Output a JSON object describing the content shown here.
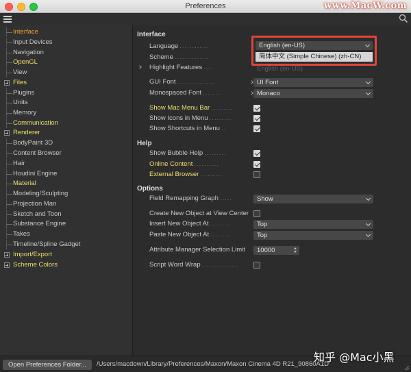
{
  "window": {
    "title": "Preferences",
    "watermark": "www.MacW.com"
  },
  "toolbar": {
    "menu_icon": "hamburger-menu-icon",
    "search_icon": "search-icon"
  },
  "sidebar": {
    "items": [
      {
        "label": "Interface",
        "expandable": false,
        "color": "orange"
      },
      {
        "label": "Input Devices",
        "expandable": false,
        "color": "normal"
      },
      {
        "label": "Navigation",
        "expandable": false,
        "color": "normal"
      },
      {
        "label": "OpenGL",
        "expandable": false,
        "color": "yellow"
      },
      {
        "label": "View",
        "expandable": false,
        "color": "normal"
      },
      {
        "label": "Files",
        "expandable": true,
        "color": "yellow"
      },
      {
        "label": "Plugins",
        "expandable": false,
        "color": "normal"
      },
      {
        "label": "Units",
        "expandable": false,
        "color": "normal"
      },
      {
        "label": "Memory",
        "expandable": false,
        "color": "normal"
      },
      {
        "label": "Communication",
        "expandable": false,
        "color": "yellow"
      },
      {
        "label": "Renderer",
        "expandable": true,
        "color": "yellow"
      },
      {
        "label": "BodyPaint 3D",
        "expandable": false,
        "color": "normal"
      },
      {
        "label": "Content Browser",
        "expandable": false,
        "color": "normal"
      },
      {
        "label": "Hair",
        "expandable": false,
        "color": "normal"
      },
      {
        "label": "Houdini Engine",
        "expandable": false,
        "color": "normal"
      },
      {
        "label": "Material",
        "expandable": false,
        "color": "yellow"
      },
      {
        "label": "Modeling/Sculpting",
        "expandable": false,
        "color": "normal"
      },
      {
        "label": "Projection Man",
        "expandable": false,
        "color": "normal"
      },
      {
        "label": "Sketch and Toon",
        "expandable": false,
        "color": "normal"
      },
      {
        "label": "Substance Engine",
        "expandable": false,
        "color": "normal"
      },
      {
        "label": "Takes",
        "expandable": false,
        "color": "normal"
      },
      {
        "label": "Timeline/Spline Gadget",
        "expandable": false,
        "color": "normal"
      },
      {
        "label": "Import/Export",
        "expandable": true,
        "color": "yellow"
      },
      {
        "label": "Scheme Colors",
        "expandable": true,
        "color": "yellow"
      }
    ]
  },
  "interface": {
    "heading": "Interface",
    "language": {
      "label": "Language",
      "value": "English (en-US)",
      "option": "简体中文 (Simple Chinese) (zh-CN)"
    },
    "scheme": {
      "label": "Scheme"
    },
    "highlight": {
      "label": "Highlight Features",
      "value": "English (en-US)"
    },
    "gui_font": {
      "label": "GUI Font",
      "value": "UI Font"
    },
    "mono_font": {
      "label": "Monospaced Font",
      "value": "Monaco"
    },
    "mac_menu_bar": {
      "label": "Show Mac Menu Bar",
      "checked": true
    },
    "icons_in_menu": {
      "label": "Show Icons in Menu",
      "checked": true
    },
    "shortcuts_in_menu": {
      "label": "Show Shortcuts in Menu",
      "checked": true
    }
  },
  "help": {
    "heading": "Help",
    "bubble_help": {
      "label": "Show Bubble Help",
      "checked": true
    },
    "online_content": {
      "label": "Online Content",
      "checked": true
    },
    "external_browser": {
      "label": "External Browser",
      "checked": false
    }
  },
  "options": {
    "heading": "Options",
    "field_remapping": {
      "label": "Field Remapping Graph",
      "value": "Show"
    },
    "create_at_view_center": {
      "label": "Create New Object at View Center",
      "checked": false
    },
    "insert_at": {
      "label": "Insert New Object At",
      "value": "Top"
    },
    "paste_at": {
      "label": "Paste New Object At",
      "value": "Top"
    },
    "attr_limit": {
      "label": "Attribute Manager Selection Limit",
      "value": "10000"
    },
    "script_wrap": {
      "label": "Script Word Wrap",
      "checked": false
    }
  },
  "footer": {
    "button": "Open Preferences Folder...",
    "path": "/Users/macdown/Library/Preferences/Maxon/Maxon Cinema 4D R21_90860A1D"
  },
  "overlay_watermark": "知乎 @Mac小黑",
  "colors": {
    "accent_yellow": "#f0de6f",
    "accent_orange": "#f0a030",
    "highlight_border": "#e0453a"
  }
}
